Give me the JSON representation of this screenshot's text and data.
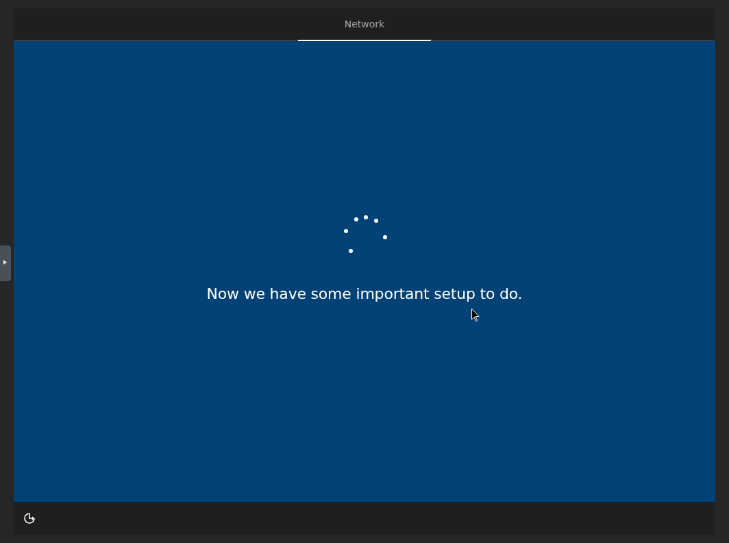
{
  "tabs": [
    {
      "label": "Network",
      "selected": true
    }
  ],
  "message": "Now we have some important setup to do."
}
